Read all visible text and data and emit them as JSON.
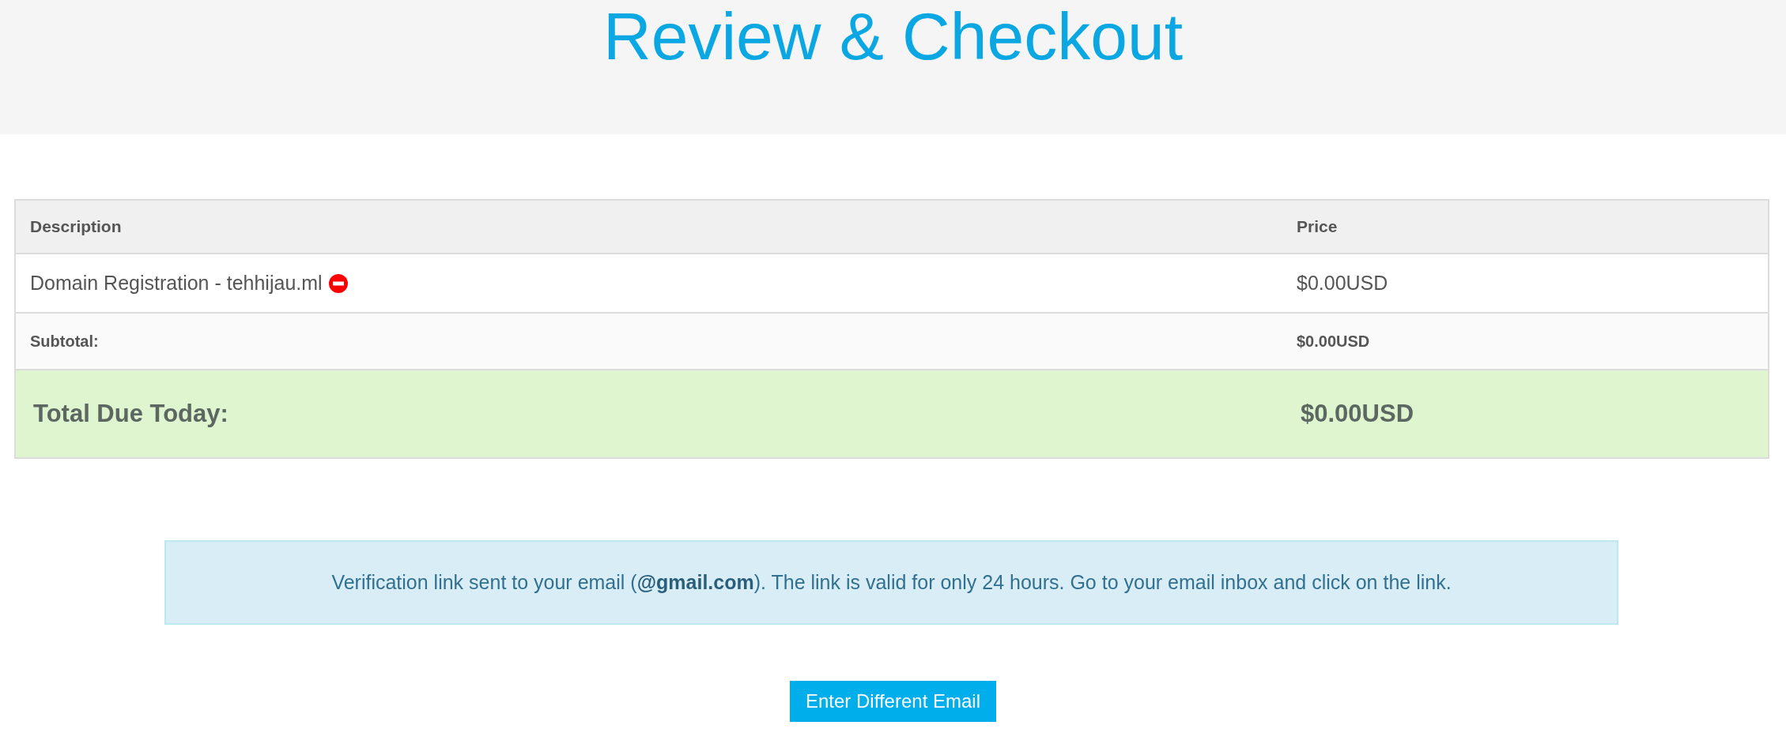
{
  "page_title": "Review & Checkout",
  "table": {
    "columns": [
      "Description",
      "Price"
    ],
    "rows": [
      {
        "kind": "item",
        "description": "Domain Registration - tehhijau.ml",
        "price": "$0.00USD",
        "removable": true
      },
      {
        "kind": "subtotal",
        "description": "Subtotal:",
        "price": "$0.00USD"
      },
      {
        "kind": "total",
        "description": "Total Due Today:",
        "price": "$0.00USD"
      }
    ]
  },
  "notice": "Verification link sent to your email (**@gmail.com**). The link is valid for only 24 hours. Go to your email inbox and click on the link.",
  "button": "Enter Different Email"
}
